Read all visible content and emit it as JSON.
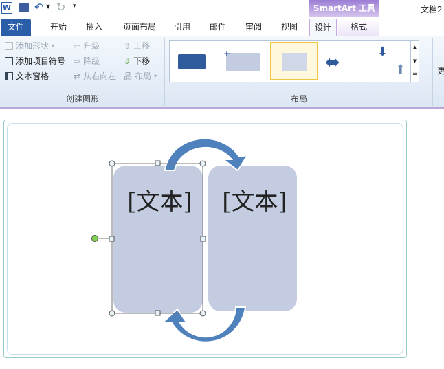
{
  "titlebar": {
    "app_icon": "W",
    "doc_title": "文档2",
    "context_tab": "SmartArt 工具"
  },
  "tabs": [
    {
      "label": "文件"
    },
    {
      "label": "开始"
    },
    {
      "label": "插入"
    },
    {
      "label": "页面布局"
    },
    {
      "label": "引用"
    },
    {
      "label": "邮件"
    },
    {
      "label": "审阅"
    },
    {
      "label": "视图"
    },
    {
      "label": "设计"
    },
    {
      "label": "格式"
    }
  ],
  "ribbon": {
    "create": {
      "add_shape": "添加形状",
      "add_bullet": "添加项目符号",
      "text_pane": "文本窗格",
      "promote": "升级",
      "demote": "降级",
      "rtl": "从右向左",
      "move_up": "上移",
      "move_down": "下移",
      "layout": "布局",
      "group_label": "创建图形"
    },
    "layouts": {
      "group_label": "布局",
      "more": "更"
    }
  },
  "smartart": {
    "shape1_text": "[文本]",
    "shape2_text": "[文本]",
    "fill": "#c3cce0",
    "arrow": "#4f81bd"
  },
  "colors": {
    "file_tab": "#2a5ea8",
    "accent": "#8b6fc4"
  }
}
